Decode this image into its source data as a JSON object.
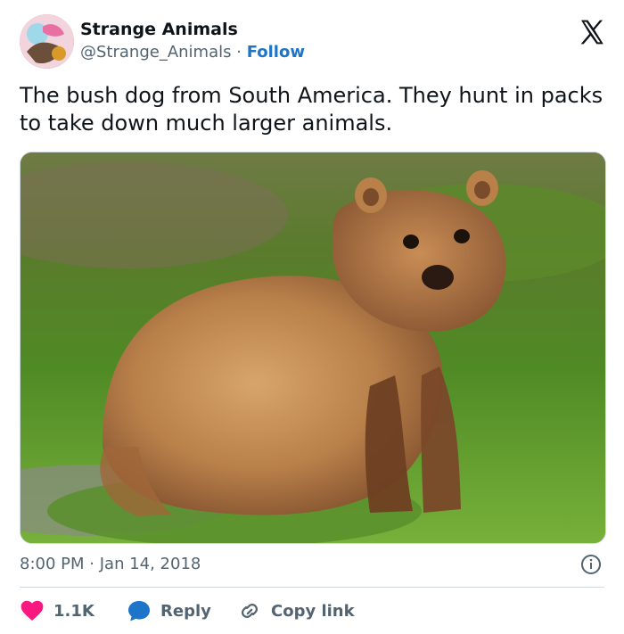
{
  "author": {
    "name": "Strange Animals",
    "handle": "@Strange_Animals",
    "separator": "·",
    "follow_label": "Follow",
    "avatar_icon": "avatar-image"
  },
  "platform_icon": "x-logo-icon",
  "tweet": {
    "text": "The bush dog from South America. They hunt in packs to take down much larger animals.",
    "image_icon": "bush-dog-photo"
  },
  "meta": {
    "time": "8:00 PM",
    "separator": "·",
    "date": "Jan 14, 2018",
    "info_icon": "info-icon"
  },
  "actions": {
    "like_count": "1.1K",
    "reply_label": "Reply",
    "copy_label": "Copy link",
    "like_icon": "heart-icon",
    "reply_icon": "speech-bubble-icon",
    "copy_icon": "link-icon"
  },
  "colors": {
    "accent": "#1d74c8",
    "heart": "#f91880",
    "text_secondary": "#536471",
    "divider": "#cfd9de"
  }
}
